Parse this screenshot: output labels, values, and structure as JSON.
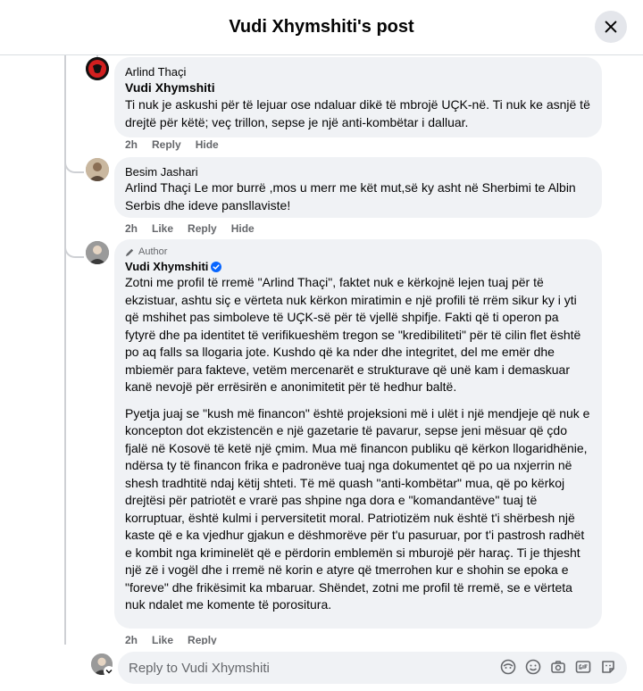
{
  "header": {
    "title": "Vudi Xhymshiti's post"
  },
  "comments": [
    {
      "author": "Arlind Thaçi",
      "mention": "Vudi Xhymshiti",
      "text": "Ti nuk je askushi për të lejuar ose ndaluar dikë të mbrojë UÇK-në. Ti nuk ke asnjë të drejtë për këtë; veç trillon, sepse je një anti-kombëtar i dalluar.",
      "time": "2h",
      "actions": [
        "Reply",
        "Hide"
      ]
    },
    {
      "author": "Besim Jashari",
      "text": "Arlind Thaçi Le mor burrë ,mos u merr me kët mut,së ky asht në Sherbimi te Albin Serbis dhe ideve pansllaviste!",
      "time": "2h",
      "actions": [
        "Like",
        "Reply",
        "Hide"
      ]
    },
    {
      "badge": "Author",
      "author": "Vudi Xhymshiti",
      "paragraph1": "Zotni me profil të rremë \"Arlind Thaçi\", faktet nuk e kërkojnë lejen tuaj për të ekzistuar, ashtu siç e vërteta nuk kërkon miratimin e një profili të rrëm sikur ky i yti që mshihet pas simboleve të UÇK-së për të vjellë shpifje. Fakti që ti operon pa fytyrë dhe pa identitet të verifikueshëm tregon se \"kredibiliteti\" për të cilin flet është po aq falls sa llogaria jote. Kushdo që ka nder dhe integritet, del me emër dhe mbiemër para fakteve, vetëm mercenarët e strukturave që unë kam i demaskuar kanë nevojë për errësirën e anonimitetit për të hedhur baltë.",
      "paragraph2": "Pyetja juaj se \"kush më financon\" është projeksioni më i ulët i një mendjeje që nuk e koncepton dot ekzistencën e një gazetarie të pavarur, sepse jeni mësuar që çdo fjalë në Kosovë të ketë një çmim. Mua më financon publiku që kërkon llogaridhënie, ndërsa ty të financon frika e padronëve tuaj nga dokumentet që po ua nxjerrin në shesh tradhtitë ndaj këtij shteti. Të më quash \"anti-kombëtar\" mua, që po kërkoj drejtësi për patriotët e vrarë pas shpine nga dora e \"komandantëve\" tuaj të korruptuar, është kulmi i perversitetit moral. Patriotizëm nuk është t'i shërbesh një kaste që e ka vjedhur gjakun e dëshmorëve për t'u pasuruar, por t'i pastrosh radhët e kombit nga kriminelët që e përdorin emblemën si mburojë për haraç. Ti je thjesht një zë i vogël dhe i rremë në korin e atyre që tmerrohen kur e shohin se epoka e \"foreve\" dhe frikësimit ka mbaruar. Shëndet, zotni me profil të rremë, se e vërteta nuk ndalet me komente të porositura.",
      "time": "2h",
      "actions": [
        "Like",
        "Reply"
      ]
    }
  ],
  "reply": {
    "placeholder": "Reply to Vudi Xhymshiti",
    "icons": [
      "avatar-sticker-icon",
      "emoji-icon",
      "camera-icon",
      "gif-icon",
      "sticker-icon"
    ]
  },
  "colors": {
    "bubble": "#f0f2f5",
    "verified": "#0866ff",
    "muted": "#65676b"
  }
}
